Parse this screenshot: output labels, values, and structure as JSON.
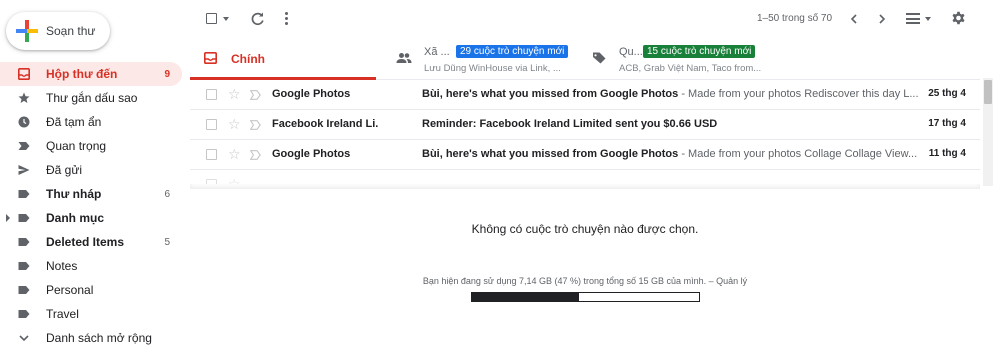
{
  "compose": {
    "label": "Soạn thư"
  },
  "sidebar": {
    "items": [
      {
        "label": "Hộp thư đến",
        "count": "9",
        "icon": "inbox-icon"
      },
      {
        "label": "Thư gắn dấu sao",
        "count": "",
        "icon": "star-icon"
      },
      {
        "label": "Đã tạm ẩn",
        "count": "",
        "icon": "clock-icon"
      },
      {
        "label": "Quan trọng",
        "count": "",
        "icon": "important-icon"
      },
      {
        "label": "Đã gửi",
        "count": "",
        "icon": "send-icon"
      },
      {
        "label": "Thư nháp",
        "count": "6",
        "icon": "draft-icon"
      },
      {
        "label": "Danh mục",
        "count": "",
        "icon": "label-icon"
      },
      {
        "label": "Deleted Items",
        "count": "5",
        "icon": "label-icon"
      },
      {
        "label": "Notes",
        "count": "",
        "icon": "label-icon"
      },
      {
        "label": "Personal",
        "count": "",
        "icon": "label-icon"
      },
      {
        "label": "Travel",
        "count": "",
        "icon": "label-icon"
      },
      {
        "label": "Danh sách mở rộng",
        "count": "",
        "icon": "chevron-down-icon"
      }
    ]
  },
  "toolbar": {
    "pager": "1–50 trong số 70"
  },
  "tabs": [
    {
      "name": "Chính",
      "badge": "",
      "sub": ""
    },
    {
      "name": "Xã ...",
      "badge": "29 cuộc trò chuyện mới",
      "sub": "Lưu Dũng WinHouse via Link, ..."
    },
    {
      "name": "Qu...",
      "badge": "15 cuộc trò chuyện mới",
      "sub": "ACB, Grab Việt Nam, Taco from..."
    }
  ],
  "emails": [
    {
      "sender": "Google Photos",
      "subject": "Bùi, here's what you missed from Google Photos",
      "snippet": " - Made from your photos Rediscover this day L...",
      "date": "25 thg 4"
    },
    {
      "sender": "Facebook Ireland Li.",
      "subject": "Reminder: Facebook Ireland Limited sent you $0.66 USD",
      "snippet": "",
      "date": "17 thg 4"
    },
    {
      "sender": "Google Photos",
      "subject": "Bùi, here's what you missed from Google Photos",
      "snippet": " - Made from your photos Collage Collage View...",
      "date": "11 thg 4"
    }
  ],
  "reading_pane": {
    "empty_message": "Không có cuộc trò chuyện nào được chọn."
  },
  "storage": {
    "text": "Bạn hiện đang sử dụng 7,14 GB (47 %) trong tổng số 15 GB của mình.",
    "separator": " – ",
    "manage_label": "Quản lý",
    "used_fraction": 0.47
  },
  "colors": {
    "accent_red": "#d93025",
    "badge_blue": "#1a73e8",
    "badge_green": "#188038"
  }
}
